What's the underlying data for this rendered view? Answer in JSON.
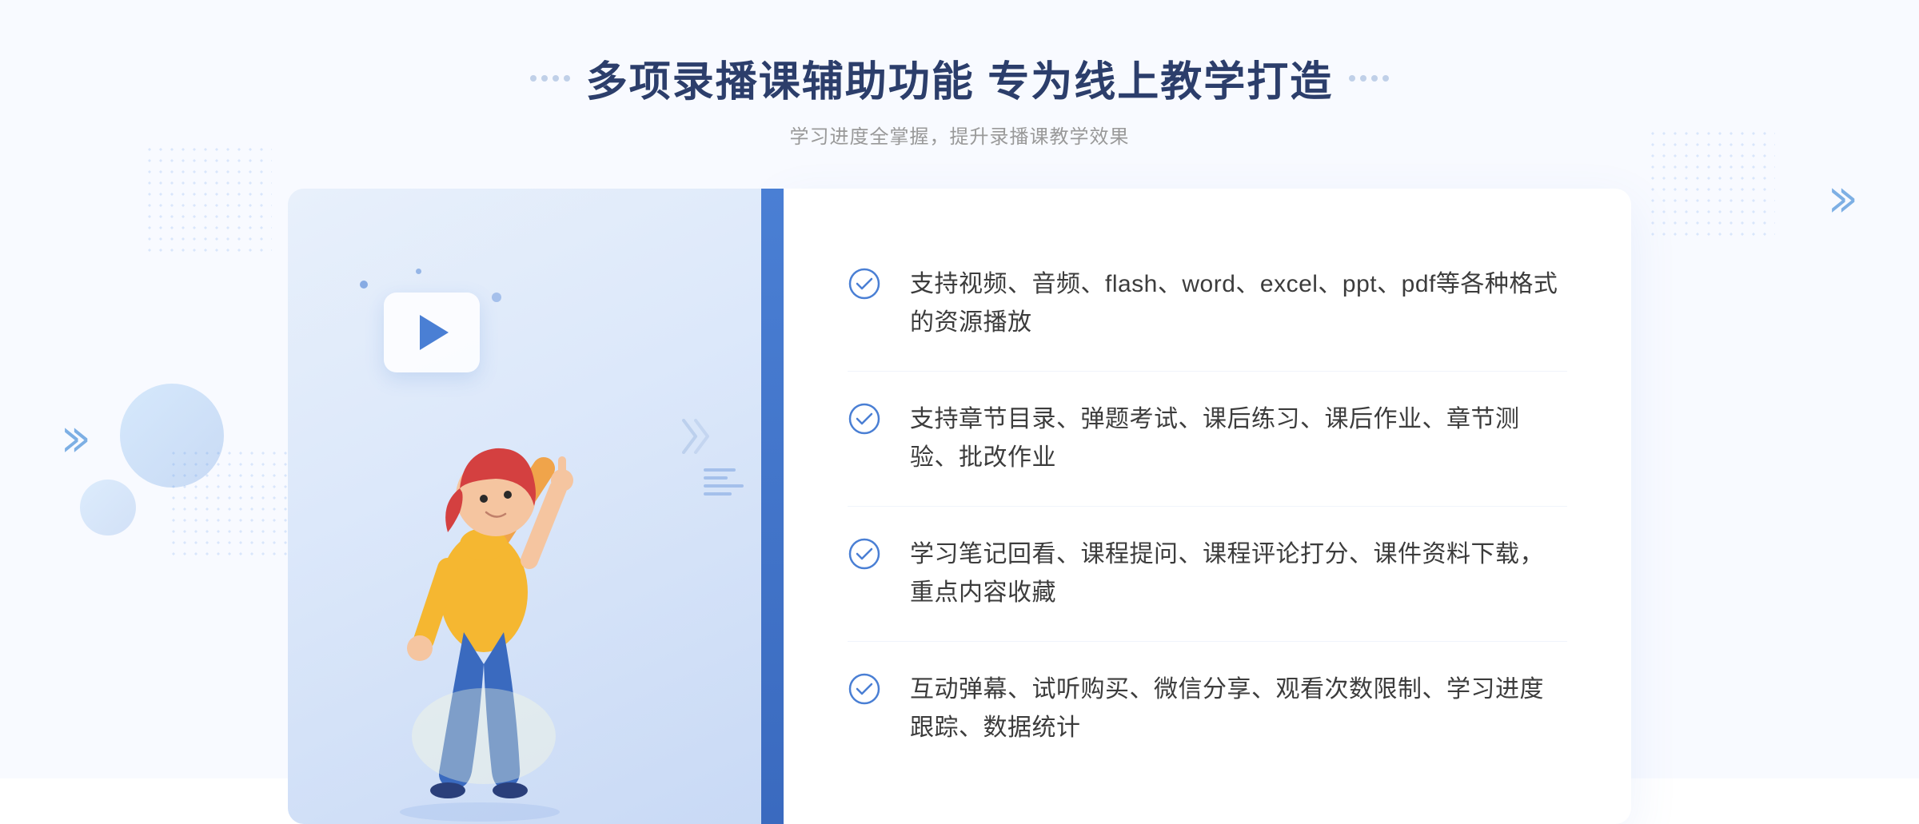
{
  "header": {
    "title": "多项录播课辅助功能 专为线上教学打造",
    "subtitle": "学习进度全掌握，提升录播课教学效果",
    "decorator_dots": [
      "·",
      "·",
      "·",
      "·",
      "·",
      "·",
      "·",
      "·"
    ]
  },
  "features": [
    {
      "id": 1,
      "text": "支持视频、音频、flash、word、excel、ppt、pdf等各种格式的资源播放"
    },
    {
      "id": 2,
      "text": "支持章节目录、弹题考试、课后练习、课后作业、章节测验、批改作业"
    },
    {
      "id": 3,
      "text": "学习笔记回看、课程提问、课程评论打分、课件资料下载，重点内容收藏"
    },
    {
      "id": 4,
      "text": "互动弹幕、试听购买、微信分享、观看次数限制、学习进度跟踪、数据统计"
    }
  ],
  "colors": {
    "primary": "#4a7fd4",
    "title": "#2c3e6b",
    "text": "#3c3c3c",
    "subtitle": "#999999",
    "bg": "#f8faff"
  }
}
